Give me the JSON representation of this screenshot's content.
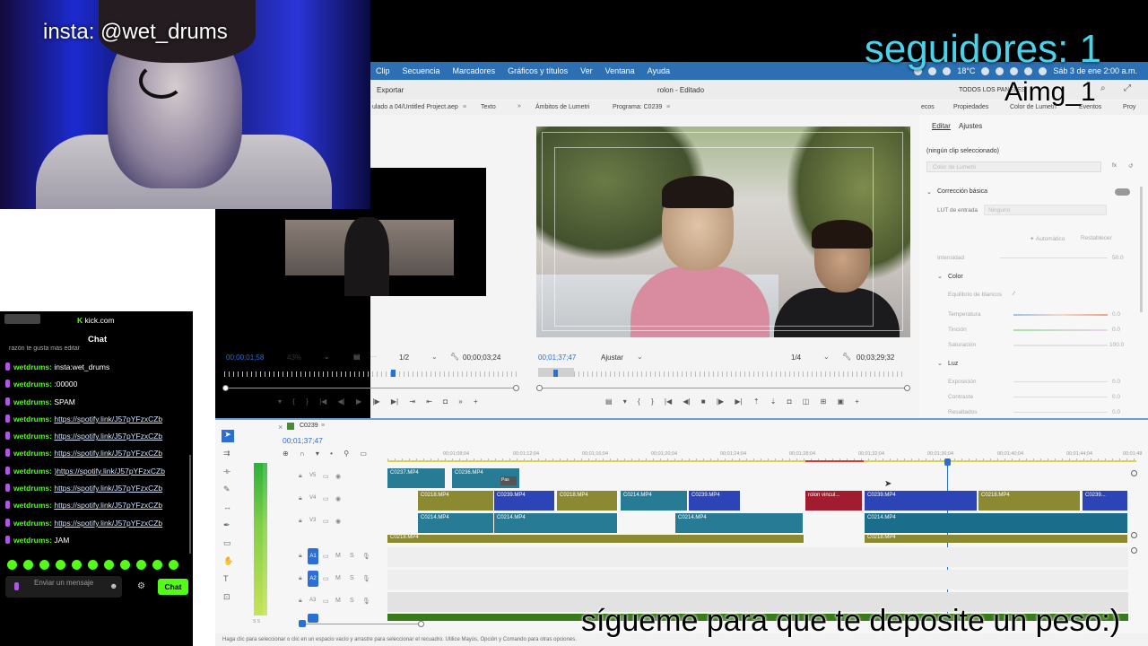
{
  "overlay": {
    "insta": "insta: @wet_drums",
    "followers": "seguidores: 1",
    "aimg": "Aimg_1",
    "cta": "sígueme para que te deposite un peso:)"
  },
  "menubar": {
    "items": [
      "Clip",
      "Secuencia",
      "Marcadores",
      "Gráficos y títulos",
      "Ver",
      "Ventana",
      "Ayuda"
    ],
    "temp": "18°C",
    "clock": "Sáb 3 de ene  2:00 a.m."
  },
  "premiere": {
    "export": "Exportar",
    "title": "rolon",
    "title_suffix": "Editado",
    "workspace": "TODOS LOS PANELES",
    "source_tabs": [
      "ulado a 04/Untitled Project.aep",
      "Texto"
    ],
    "program_tabs": [
      "Ámbitos de Lumetri",
      "Programa: C0239"
    ],
    "right_tabs": [
      "ecos",
      "Propiedades",
      "Color de Lumetri",
      "Eventos",
      "Proy"
    ],
    "lumetri": {
      "tabs": [
        "Editar",
        "Ajustes"
      ],
      "no_clip": "(ningún clip seleccionado)",
      "preset": "Color de Lumetri",
      "basic": "Corrección básica",
      "lut": "LUT de entrada",
      "lut_value": "Ninguno",
      "auto": "Automático",
      "reset": "Restablecer",
      "intensity": "Intensidad",
      "color_section": "Color",
      "white_balance": "Equilibrio de blancos",
      "temperature": "Temperatura",
      "tint": "Tinción",
      "saturation": "Saturación",
      "light_section": "Luz",
      "exposure": "Exposición",
      "contrast": "Contraste",
      "highlights": "Resaltados",
      "values": [
        "50.0",
        "0.0",
        "0.0",
        "100.0",
        "0.0",
        "0.0",
        "0.0"
      ]
    },
    "source": {
      "timecode": "00;00;01;58",
      "zoom": "43%",
      "res": "1/2",
      "duration": "00;00;03;24"
    },
    "program": {
      "timecode": "00;01;37;47",
      "fit": "Ajustar",
      "res": "1/4",
      "duration": "00;03;29;32"
    },
    "timeline": {
      "sequence": "C0239",
      "timecode": "00;01;37;47",
      "ruler": [
        "00;01;08;04",
        "00;01;12;04",
        "00;01;16;04",
        "00;01;20;04",
        "00;01;24;04",
        "00;01;28;04",
        "00;01;32;04",
        "00;01;36;04",
        "00;01;40;04",
        "00;01;44;04",
        "00;01;48"
      ],
      "video_tracks": [
        "V5",
        "V4",
        "V3"
      ],
      "audio_tracks": [
        "A1",
        "A2",
        "A3"
      ],
      "clips": {
        "c1": "C0237.MP4",
        "c2": "C0236.MP4",
        "c3": "C0218.MP4",
        "c4": "C0239.MP4",
        "c5": "C0218.MP4",
        "c6": "C0214.MP4",
        "c7": "C0239.MP4",
        "c8": "rolon vincul...",
        "c9": "C0239.MP4",
        "c10": "C0218.MP4",
        "c11": "C0239...",
        "c12": "C0214.MP4",
        "c13": "C0214.MP4",
        "c14": "C0214.MP4",
        "c15": "C0214.MP4",
        "c16": "C0218.MP4",
        "c17": "C0218.MP4",
        "c18": "Pas"
      }
    },
    "status": "Haga clic para seleccionar o clic en un espacio vacío y arrastre para seleccionar el recuadro. Utilice Mayús, Opción y Comando para otras opciones."
  },
  "chat": {
    "site": "kick.com",
    "header": "Chat",
    "truncated": "razón te gusta más editar",
    "messages": [
      {
        "user": "wetdrums:",
        "text": "insta:wet_drums",
        "link": false
      },
      {
        "user": "wetdrums:",
        "text": ":00000",
        "link": false
      },
      {
        "user": "wetdrums:",
        "text": "SPAM",
        "link": false
      },
      {
        "user": "wetdrums:",
        "text": "https://spotify.link/J57pYFzxCZb",
        "link": true
      },
      {
        "user": "wetdrums:",
        "text": "https://spotify.link/J57pYFzxCZb",
        "link": true
      },
      {
        "user": "wetdrums:",
        "text": "https://spotify.link/J57pYFzxCZb",
        "link": true
      },
      {
        "user": "wetdrums:",
        "text": ")https://spotify.link/J57pYFzxCZb",
        "link": true
      },
      {
        "user": "wetdrums:",
        "text": "https://spotify.link/J57pYFzxCZb",
        "link": true
      },
      {
        "user": "wetdrums:",
        "text": "https://spotify.link/J57pYFzxCZb",
        "link": true
      },
      {
        "user": "wetdrums:",
        "text": "https://spotify.link/J57pYFzxCZb",
        "link": true
      },
      {
        "user": "wetdrums:",
        "text": "JAM",
        "link": false
      }
    ],
    "input_placeholder": "Enviar un mensaje",
    "send_label": "Chat"
  }
}
